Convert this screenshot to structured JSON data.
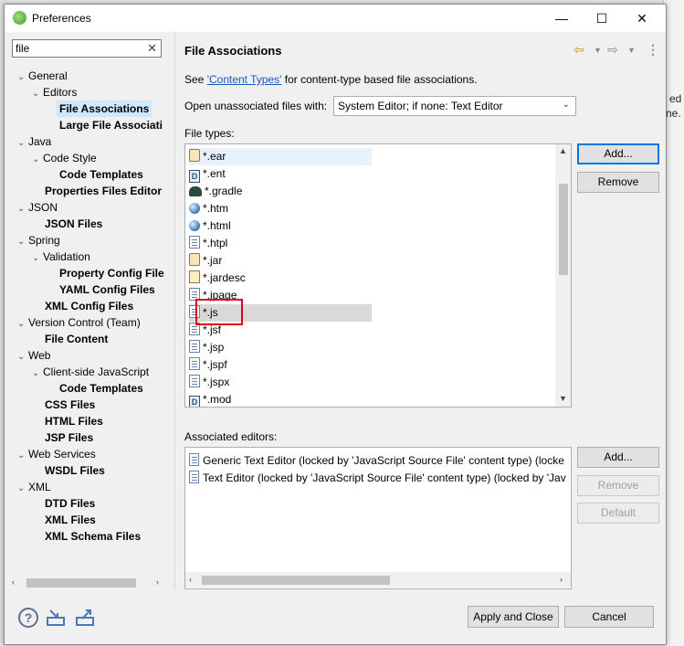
{
  "dialog": {
    "title": "Preferences",
    "window_buttons": {
      "minimize": "—",
      "maximize": "☐",
      "close": "✕"
    }
  },
  "filter": {
    "value": "file",
    "clear_glyph": "✕"
  },
  "tree": [
    {
      "label": "General",
      "arrow": "⌄",
      "bold": false
    },
    {
      "label": "Editors",
      "arrow": "⌄",
      "bold": false
    },
    {
      "label": "File Associations",
      "arrow": "",
      "bold": true,
      "selected": true
    },
    {
      "label": "Large File Associati",
      "arrow": "",
      "bold": true
    },
    {
      "label": "Java",
      "arrow": "⌄",
      "bold": false
    },
    {
      "label": "Code Style",
      "arrow": "⌄",
      "bold": false
    },
    {
      "label": "Code Templates",
      "arrow": "",
      "bold": true
    },
    {
      "label": "Properties Files Editor",
      "arrow": "",
      "bold": true
    },
    {
      "label": "JSON",
      "arrow": "⌄",
      "bold": false
    },
    {
      "label": "JSON Files",
      "arrow": "",
      "bold": true
    },
    {
      "label": "Spring",
      "arrow": "⌄",
      "bold": false
    },
    {
      "label": "Validation",
      "arrow": "⌄",
      "bold": false
    },
    {
      "label": "Property Config File",
      "arrow": "",
      "bold": true
    },
    {
      "label": "YAML Config Files",
      "arrow": "",
      "bold": true
    },
    {
      "label": "XML Config Files",
      "arrow": "",
      "bold": true
    },
    {
      "label": "Version Control (Team)",
      "arrow": "⌄",
      "bold": false
    },
    {
      "label": "File Content",
      "arrow": "",
      "bold": true
    },
    {
      "label": "Web",
      "arrow": "⌄",
      "bold": false
    },
    {
      "label": "Client-side JavaScript",
      "arrow": "⌄",
      "bold": false
    },
    {
      "label": "Code Templates",
      "arrow": "",
      "bold": true
    },
    {
      "label": "CSS Files",
      "arrow": "",
      "bold": true
    },
    {
      "label": "HTML Files",
      "arrow": "",
      "bold": true
    },
    {
      "label": "JSP Files",
      "arrow": "",
      "bold": true
    },
    {
      "label": "Web Services",
      "arrow": "⌄",
      "bold": false
    },
    {
      "label": "WSDL Files",
      "arrow": "",
      "bold": true
    },
    {
      "label": "XML",
      "arrow": "⌄",
      "bold": false
    },
    {
      "label": "DTD Files",
      "arrow": "",
      "bold": true
    },
    {
      "label": "XML Files",
      "arrow": "",
      "bold": true
    },
    {
      "label": "XML Schema Files",
      "arrow": "",
      "bold": true
    }
  ],
  "page": {
    "title": "File Associations",
    "see_prefix": "See ",
    "see_link": "'Content Types'",
    "see_suffix": " for content-type based file associations.",
    "open_label": "Open unassociated files with:",
    "open_value": "System Editor; if none: Text Editor",
    "filetypes_label": "File types:",
    "filetypes": [
      {
        "name": "*.ear",
        "icon": "jar"
      },
      {
        "name": "*.ent",
        "icon": "d"
      },
      {
        "name": "*.gradle",
        "icon": "gradle"
      },
      {
        "name": "*.htm",
        "icon": "globe"
      },
      {
        "name": "*.html",
        "icon": "globe"
      },
      {
        "name": "*.htpl",
        "icon": "doc"
      },
      {
        "name": "*.jar",
        "icon": "jar"
      },
      {
        "name": "*.jardesc",
        "icon": "jardesc"
      },
      {
        "name": "*.jpage",
        "icon": "doc"
      },
      {
        "name": "*.js",
        "icon": "doc"
      },
      {
        "name": "*.jsf",
        "icon": "doc"
      },
      {
        "name": "*.jsp",
        "icon": "doc"
      },
      {
        "name": "*.jspf",
        "icon": "doc"
      },
      {
        "name": "*.jspx",
        "icon": "doc"
      },
      {
        "name": "*.mod",
        "icon": "d"
      }
    ],
    "filetype_buttons": {
      "add": "Add...",
      "remove": "Remove"
    },
    "editors_label": "Associated editors:",
    "editors": [
      "Generic Text Editor (locked by 'JavaScript Source File' content type) (locke",
      "Text Editor (locked by 'JavaScript Source File' content type) (locked by 'Jav"
    ],
    "editor_buttons": {
      "add": "Add...",
      "remove": "Remove",
      "default": "Default"
    }
  },
  "footer": {
    "apply_close": "Apply and Close",
    "cancel": "Cancel"
  },
  "backdrop": {
    "text1": "ed",
    "text2": "ne."
  }
}
